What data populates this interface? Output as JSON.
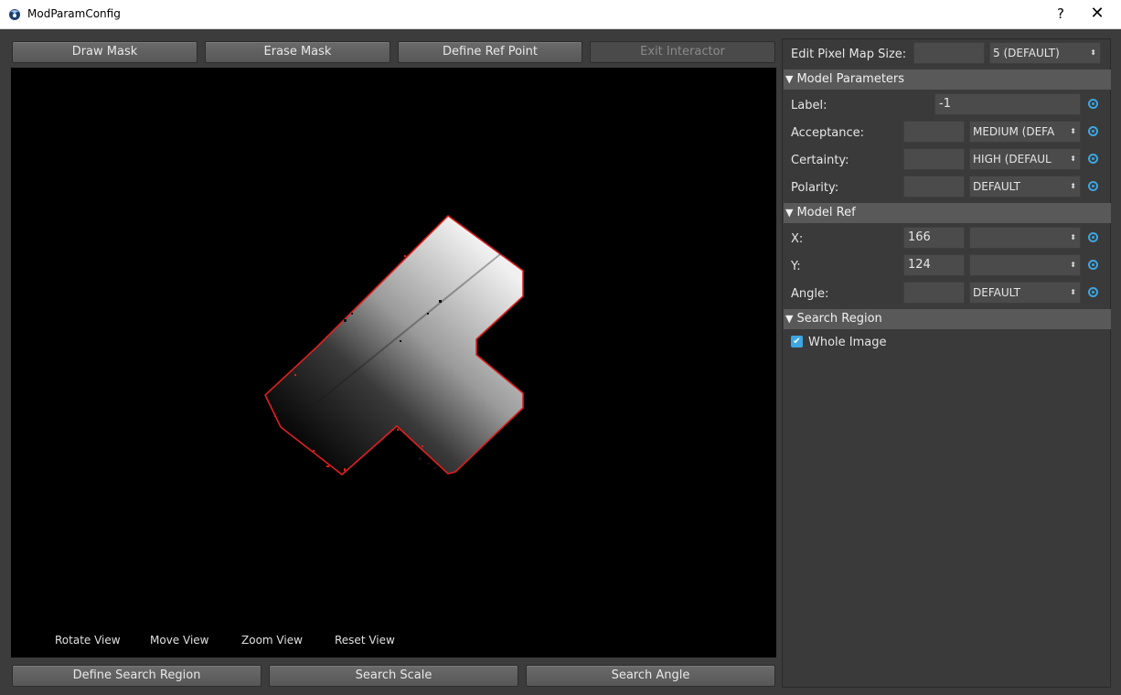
{
  "window": {
    "title": "ModParamConfig",
    "help_glyph": "?",
    "close_glyph": "✕"
  },
  "toolbar": {
    "draw_mask": "Draw Mask",
    "erase_mask": "Erase Mask",
    "define_ref_point": "Define Ref Point",
    "exit_interactor": "Exit Interactor"
  },
  "view_controls": {
    "rotate": "Rotate View",
    "move": "Move View",
    "zoom": "Zoom View",
    "reset": "Reset View"
  },
  "bottom_bar": {
    "define_search_region": "Define Search Region",
    "search_scale": "Search Scale",
    "search_angle": "Search Angle"
  },
  "panel": {
    "edit_pixel_map_size": {
      "label": "Edit Pixel Map Size:",
      "value": "",
      "select": "5 (DEFAULT)"
    },
    "model_parameters": {
      "title": "Model Parameters",
      "label": {
        "label": "Label:",
        "value": "-1"
      },
      "acceptance": {
        "label": "Acceptance:",
        "value": "",
        "select": "MEDIUM (DEFA"
      },
      "certainty": {
        "label": "Certainty:",
        "value": "",
        "select": "HIGH (DEFAUL"
      },
      "polarity": {
        "label": "Polarity:",
        "value": "",
        "select": "DEFAULT"
      }
    },
    "model_ref": {
      "title": "Model Ref",
      "x": {
        "label": "X:",
        "value": "166",
        "select": ""
      },
      "y": {
        "label": "Y:",
        "value": "124",
        "select": ""
      },
      "angle": {
        "label": "Angle:",
        "value": "",
        "select": "DEFAULT"
      }
    },
    "search_region": {
      "title": "Search Region",
      "whole_image": {
        "label": "Whole Image",
        "checked": true
      }
    }
  },
  "colors": {
    "accent": "#3ea6e0",
    "mask_outline": "#e0201e",
    "panel_bg": "#3a3a3a",
    "section_bg": "#595959"
  }
}
